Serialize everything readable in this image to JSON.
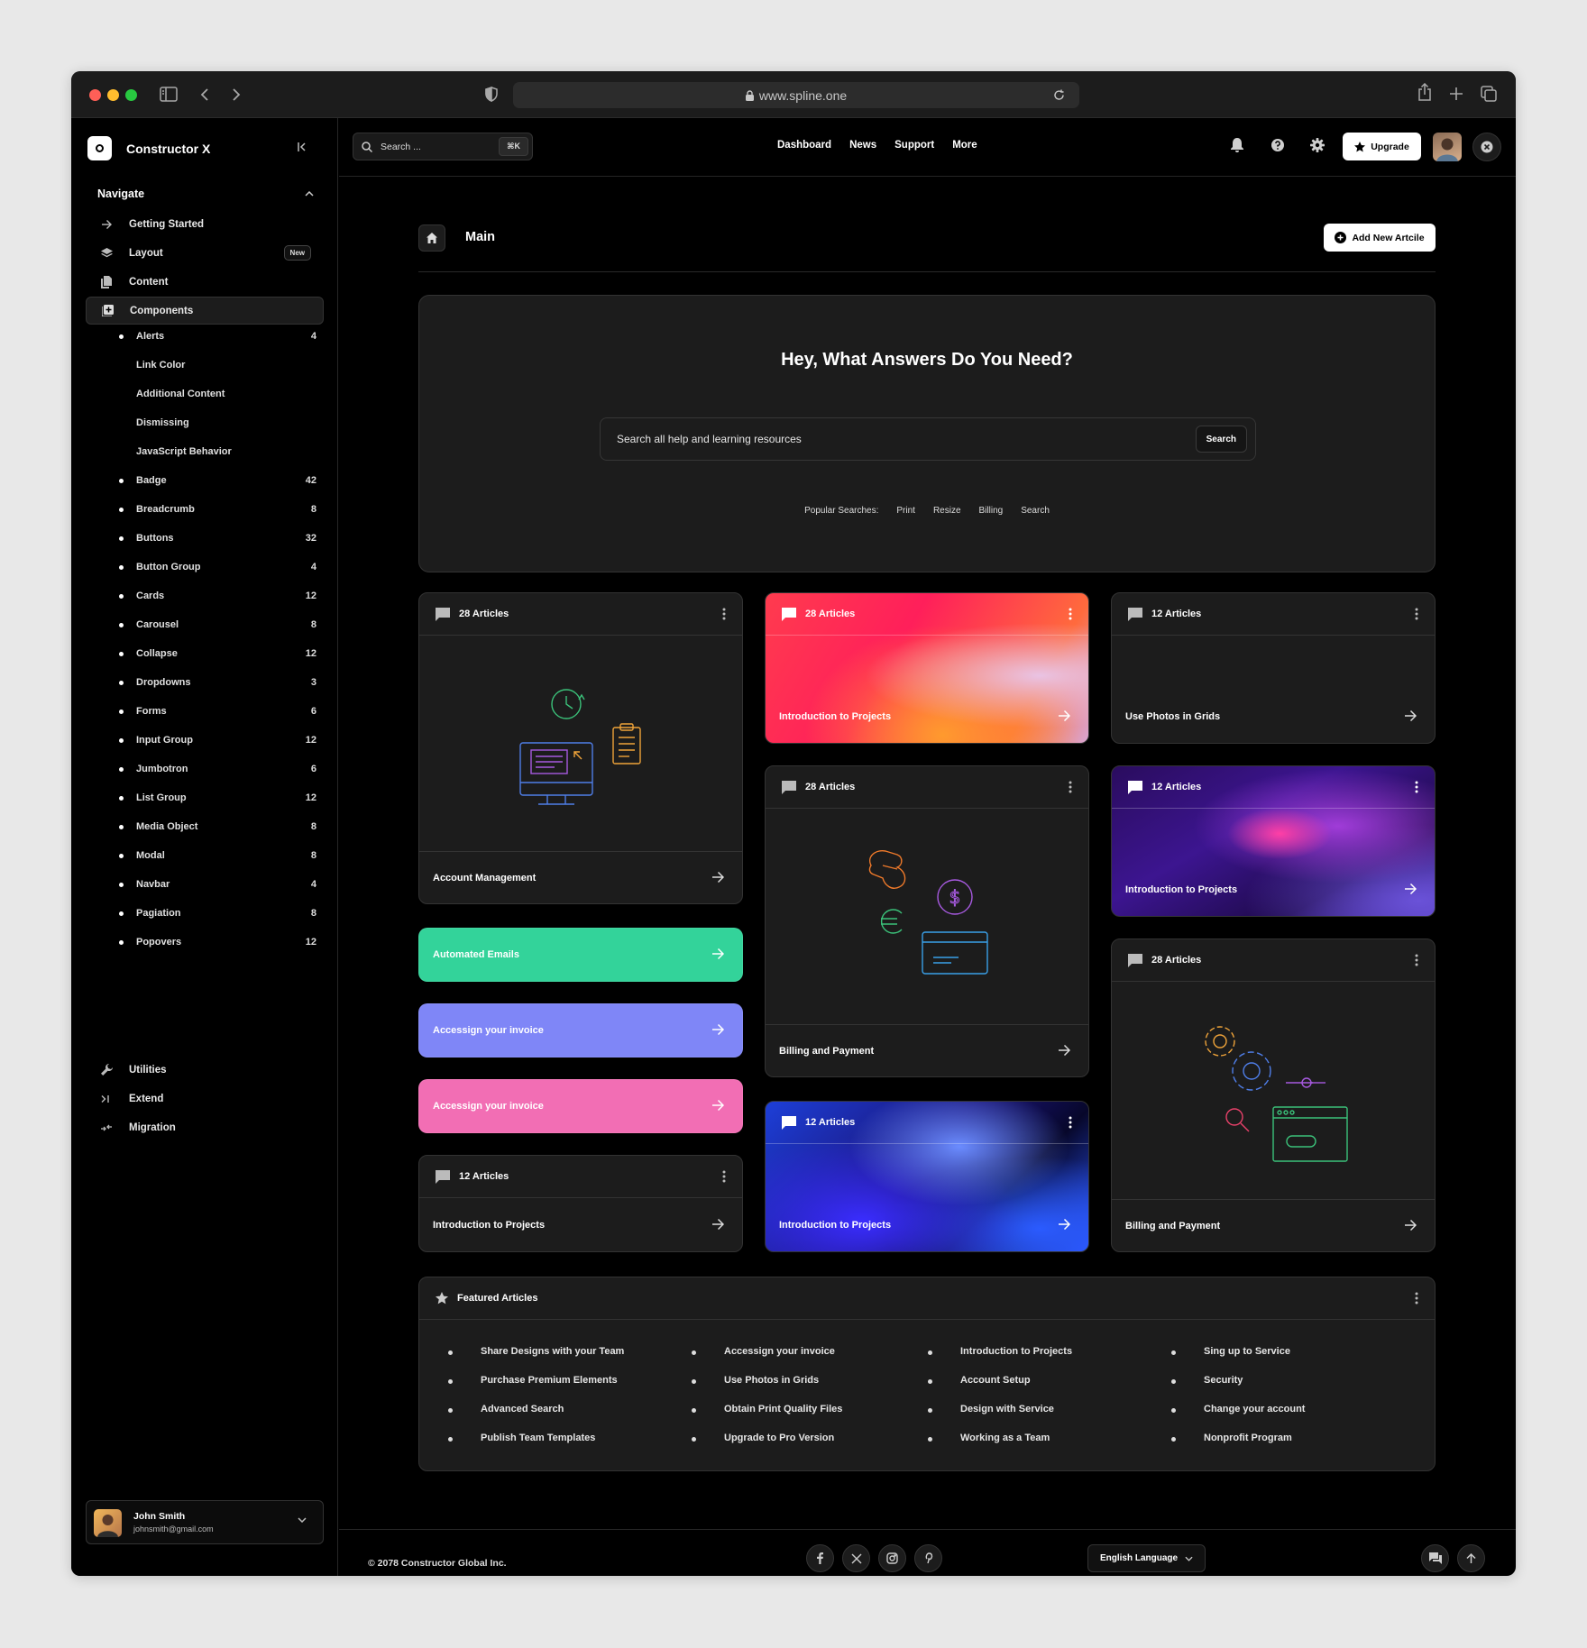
{
  "browser": {
    "url": "www.spline.one"
  },
  "brand": {
    "name": "Constructor X"
  },
  "sidebar": {
    "section_title": "Navigate",
    "items": [
      {
        "label": "Getting Started",
        "icon": "arrow-right-icon"
      },
      {
        "label": "Layout",
        "icon": "layers-icon",
        "badge": "New"
      },
      {
        "label": "Content",
        "icon": "file-icon"
      },
      {
        "label": "Components",
        "icon": "plus-square-icon",
        "active": true
      },
      {
        "label": "Utilities",
        "icon": "wrench-icon"
      },
      {
        "label": "Extend",
        "icon": "terminal-icon"
      },
      {
        "label": "Migration",
        "icon": "migrate-icon"
      }
    ],
    "components": [
      {
        "label": "Alerts",
        "count": "4",
        "bullet": true
      },
      {
        "label": "Link Color",
        "count": "",
        "bullet": false
      },
      {
        "label": "Additional Content",
        "count": "",
        "bullet": false
      },
      {
        "label": "Dismissing",
        "count": "",
        "bullet": false
      },
      {
        "label": "JavaScript Behavior",
        "count": "",
        "bullet": false
      },
      {
        "label": "Badge",
        "count": "42",
        "bullet": true
      },
      {
        "label": "Breadcrumb",
        "count": "8",
        "bullet": true
      },
      {
        "label": "Buttons",
        "count": "32",
        "bullet": true
      },
      {
        "label": "Button Group",
        "count": "4",
        "bullet": true
      },
      {
        "label": "Cards",
        "count": "12",
        "bullet": true
      },
      {
        "label": "Carousel",
        "count": "8",
        "bullet": true
      },
      {
        "label": "Collapse",
        "count": "12",
        "bullet": true
      },
      {
        "label": "Dropdowns",
        "count": "3",
        "bullet": true
      },
      {
        "label": "Forms",
        "count": "6",
        "bullet": true
      },
      {
        "label": "Input Group",
        "count": "12",
        "bullet": true
      },
      {
        "label": "Jumbotron",
        "count": "6",
        "bullet": true
      },
      {
        "label": "List Group",
        "count": "12",
        "bullet": true
      },
      {
        "label": "Media Object",
        "count": "8",
        "bullet": true
      },
      {
        "label": "Modal",
        "count": "8",
        "bullet": true
      },
      {
        "label": "Navbar",
        "count": "4",
        "bullet": true
      },
      {
        "label": "Pagiation",
        "count": "8",
        "bullet": true
      },
      {
        "label": "Popovers",
        "count": "12",
        "bullet": true
      }
    ],
    "user": {
      "name": "John Smith",
      "email": "johnsmith@gmail.com"
    }
  },
  "topbar": {
    "search_placeholder": "Search ...",
    "shortcut": "⌘K",
    "nav": [
      "Dashboard",
      "News",
      "Support",
      "More"
    ],
    "upgrade_label": "Upgrade"
  },
  "main": {
    "title": "Main",
    "add_button": "Add New Artcile",
    "hero": {
      "title": "Hey, What Answers Do You Need?",
      "search_placeholder": "Search all help and learning resources",
      "search_button": "Search",
      "popular_label": "Popular Searches:",
      "popular": [
        "Print",
        "Resize",
        "Billing",
        "Search"
      ]
    },
    "cards": {
      "c1": {
        "count": "28 Articles",
        "title": "Account Management"
      },
      "c2": {
        "count": "28 Articles",
        "title": "Introduction to Projects"
      },
      "c3": {
        "count": "12 Articles",
        "title": "Use Photos in Grids"
      },
      "c4": {
        "count": "28 Articles",
        "title": "Billing and Payment"
      },
      "c5": {
        "count": "12 Articles",
        "title": "Introduction to Projects"
      },
      "c6": {
        "count": "28 Articles",
        "title": "Billing and Payment"
      },
      "c7": {
        "count": "12 Articles",
        "title": "Introduction to Projects"
      },
      "c8": {
        "count": "12 Articles",
        "title": "Introduction to Projects"
      }
    },
    "pills": [
      {
        "label": "Automated Emails",
        "color": "#33d39a"
      },
      {
        "label": "Accessign your invoice",
        "color": "#7f86f7"
      },
      {
        "label": "Accessign your invoice",
        "color": "#f26eb4"
      }
    ],
    "featured": {
      "title": "Featured Articles",
      "columns": [
        [
          "Share Designs with your Team",
          "Purchase Premium Elements",
          "Advanced Search",
          "Publish Team Templates"
        ],
        [
          "Accessign your invoice",
          "Use Photos in Grids",
          "Obtain Print Quality Files",
          "Upgrade to Pro Version"
        ],
        [
          "Introduction to Projects",
          "Account Setup",
          "Design with Service",
          "Working as a Team"
        ],
        [
          "Sing up to Service",
          "Security",
          "Change your account",
          "Nonprofit Program"
        ]
      ]
    }
  },
  "footer": {
    "copyright": "© 2078 Constructor Global Inc.",
    "language": "English Language"
  }
}
